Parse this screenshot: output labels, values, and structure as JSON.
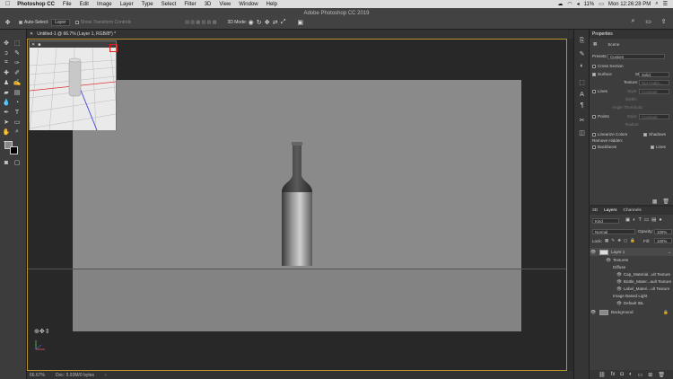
{
  "menubar": {
    "app": "Photoshop CC",
    "items": [
      "File",
      "Edit",
      "Image",
      "Layer",
      "Type",
      "Select",
      "Filter",
      "3D",
      "View",
      "Window",
      "Help"
    ],
    "battery": "11%",
    "clock": "Mon 12:26:28 PM"
  },
  "options": {
    "auto_select_label": "Auto-Select:",
    "auto_select_value": "Layer",
    "show_transform": "Show Transform Controls",
    "mode_label": "3D Mode:",
    "window_title": "Adobe Photoshop CC 2019"
  },
  "document": {
    "tab_title": "Untitled-1 @ 66.7% (Layer 1, RGB/8*) *"
  },
  "status": {
    "zoom": "66.67%",
    "doc_size": "Doc: 5.93M/0 bytes"
  },
  "properties": {
    "panel_title": "Properties",
    "scene_label": "Scene",
    "presets_label": "Presets:",
    "presets_value": "Custom",
    "cross_section": "Cross Section",
    "surface": "Surface",
    "style_label": "Style:",
    "surface_style": "Solid",
    "texture_label": "Texture:",
    "texture_value": "Not Availa...",
    "lines": "Lines",
    "lines_style": "Constant",
    "width_label": "Width:",
    "angle_threshold": "Angle Threshold:",
    "points": "Points",
    "points_style": "Constant",
    "radius_label": "Radius:",
    "linearize": "Linearize Colors",
    "shadows": "Shadows",
    "remove_hidden": "Remove Hidden:",
    "backfaces": "Backfaces",
    "lines_check": "Lines"
  },
  "layers": {
    "tabs": [
      "3D",
      "Layers",
      "Channels"
    ],
    "kind": "Kind",
    "blend": "Normal",
    "opacity_label": "Opacity:",
    "opacity": "100%",
    "lock_label": "Lock:",
    "fill_label": "Fill:",
    "fill": "100%",
    "rows": [
      "Layer 1",
      "Textures",
      "Diffuse",
      "Cap_Material...ult Texture",
      "Bottle_Mater...ault Texture",
      "Label_Materi...ult Texture",
      "Image Based Light",
      "Default IBL",
      "Background"
    ]
  },
  "colors": {
    "accent": "#b8942e",
    "canvas_bg": "#8a8a8a",
    "panel_bg": "#3d3d3d"
  }
}
